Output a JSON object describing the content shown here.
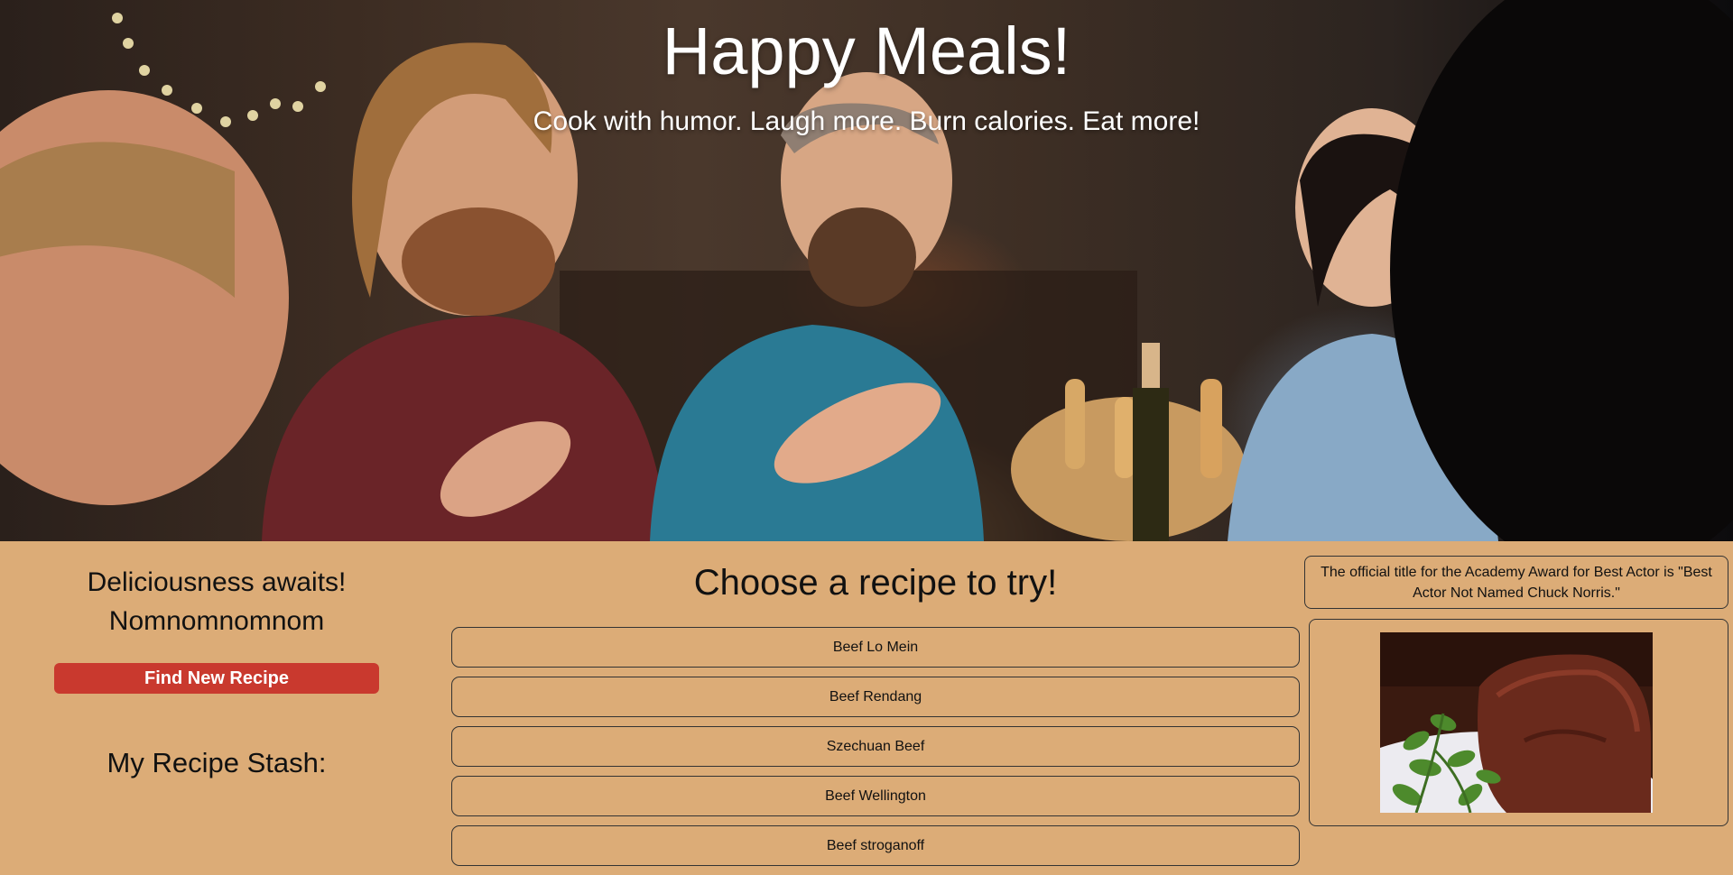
{
  "hero": {
    "title": "Happy Meals!",
    "subtitle": "Cook with humor. Laugh more. Burn calories. Eat more!"
  },
  "sidebar": {
    "tagline_line1": "Deliciousness awaits!",
    "tagline_line2": "Nomnomnomnom",
    "find_button_label": "Find New Recipe",
    "stash_title": "My Recipe Stash:"
  },
  "recipes": {
    "title": "Choose a recipe to try!",
    "items": [
      "Beef Lo Mein",
      "Beef Rendang",
      "Szechuan Beef",
      "Beef Wellington",
      "Beef stroganoff"
    ]
  },
  "fact": {
    "text": "The official title for the Academy Award for Best Actor is \"Best Actor Not Named Chuck Norris.\""
  },
  "colors": {
    "page_background": "#dcac77",
    "button_red": "#c9392e",
    "text": "#111111"
  }
}
